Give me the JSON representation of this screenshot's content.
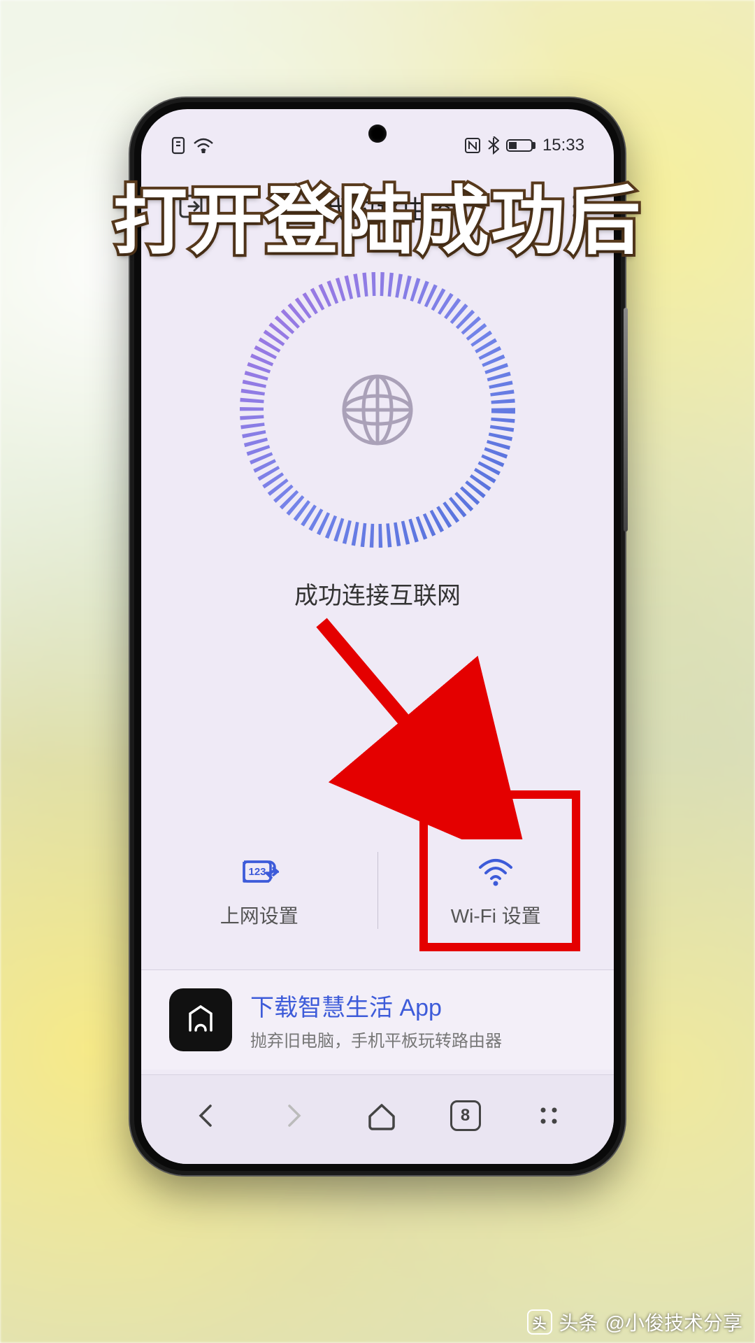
{
  "caption": "打开登陆成功后",
  "status_bar": {
    "time": "15:33"
  },
  "app_header": {
    "title": "我的路由器"
  },
  "connection_status": "成功连接互联网",
  "buttons": {
    "internet": {
      "label": "上网设置"
    },
    "wifi": {
      "label": "Wi-Fi 设置"
    }
  },
  "promo": {
    "title": "下载智慧生活 App",
    "subtitle": "抛弃旧电脑，手机平板玩转路由器"
  },
  "browser": {
    "tab_count": "8"
  },
  "watermark": {
    "prefix": "头条",
    "author": "@小俊技术分享"
  }
}
